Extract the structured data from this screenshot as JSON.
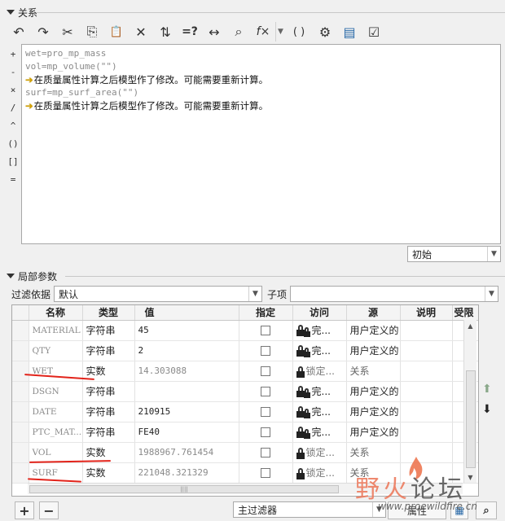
{
  "relations": {
    "section_title": "关系",
    "toolbar": [
      {
        "name": "undo-icon",
        "glyph": "↶"
      },
      {
        "name": "redo-icon",
        "glyph": "↷"
      },
      {
        "name": "cut-icon",
        "glyph": "✂"
      },
      {
        "name": "copy-icon",
        "glyph": "⎘"
      },
      {
        "name": "paste-icon",
        "glyph": "📋"
      },
      {
        "name": "delete-icon",
        "glyph": "✕"
      },
      {
        "name": "switch-dimensions-icon",
        "glyph": "⇅"
      },
      {
        "name": "evaluate-icon",
        "glyph": "=?"
      },
      {
        "name": "insert-dimension-icon",
        "glyph": "↔"
      },
      {
        "name": "insert-parameter-icon",
        "glyph": "⌕"
      },
      {
        "name": "insert-function-icon",
        "glyph": "f×"
      },
      {
        "name": "insert-brackets-icon",
        "glyph": "( )"
      },
      {
        "name": "verify-icon",
        "glyph": "⚙"
      },
      {
        "name": "sort-relations-icon",
        "glyph": "▤"
      },
      {
        "name": "check-icon",
        "glyph": "☑"
      }
    ],
    "operators": [
      "+",
      "-",
      "×",
      "/",
      "^",
      "()",
      "[]",
      "="
    ],
    "lines": [
      {
        "type": "code",
        "text": "wet=pro_mp_mass"
      },
      {
        "type": "code",
        "text": "vol=mp_volume(\"\")"
      },
      {
        "type": "warn",
        "text": "在质量属性计算之后模型作了修改。可能需要重新计算。"
      },
      {
        "type": "code",
        "text": "surf=mp_surf_area(\"\")"
      },
      {
        "type": "warn",
        "text": "在质量属性计算之后模型作了修改。可能需要重新计算。"
      }
    ],
    "mode_select": "初始"
  },
  "local_params": {
    "section_title": "局部参数",
    "filter_label": "过滤依据",
    "filter_value": "默认",
    "subitem_label": "子项",
    "subitem_value": "",
    "columns": [
      "名称",
      "类型",
      "值",
      "指定",
      "访问",
      "源",
      "说明",
      "受限"
    ],
    "rows": [
      {
        "name": "MATERIAL",
        "type": "字符串",
        "value": "45",
        "access": "完...",
        "source": "用户定义的",
        "locked": false
      },
      {
        "name": "QTY",
        "type": "字符串",
        "value": "2",
        "access": "完...",
        "source": "用户定义的",
        "locked": false
      },
      {
        "name": "WET",
        "type": "实数",
        "value": "14.303088",
        "access": "锁定...",
        "source": "关系",
        "locked": true
      },
      {
        "name": "DSGN",
        "type": "字符串",
        "value": "",
        "access": "完...",
        "source": "用户定义的",
        "locked": false
      },
      {
        "name": "DATE",
        "type": "字符串",
        "value": "210915",
        "access": "完...",
        "source": "用户定义的",
        "locked": false
      },
      {
        "name": "PTC_MAT...",
        "type": "字符串",
        "value": "FE40",
        "access": "完...",
        "source": "用户定义的",
        "locked": false
      },
      {
        "name": "VOL",
        "type": "实数",
        "value": "1988967.761454",
        "access": "锁定...",
        "source": "关系",
        "locked": true
      },
      {
        "name": "SURF",
        "type": "实数",
        "value": "221048.321329",
        "access": "锁定...",
        "source": "关系",
        "locked": true
      }
    ],
    "main_filter": "主过滤器",
    "properties_button": "属性",
    "add_button": "+",
    "remove_button": "−"
  },
  "watermark": {
    "brand": "野火论坛",
    "url": "www.proewildfire.cn"
  },
  "colors": {
    "accent_annotation": "#e2231a",
    "warning_arrow": "#d4a000"
  }
}
